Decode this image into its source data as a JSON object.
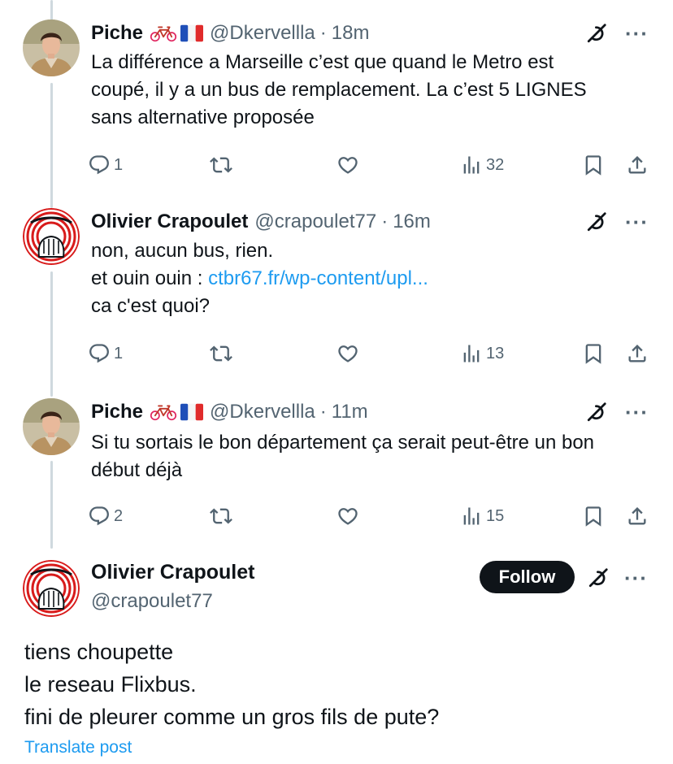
{
  "colors": {
    "text": "#0f1419",
    "secondary": "#536471",
    "link": "#1d9bf0",
    "thread_line": "#cfd9de",
    "follow_bg": "#0f1419"
  },
  "replies": [
    {
      "name": "Piche",
      "handle": "@Dkervellla",
      "separator": "·",
      "time": "18m",
      "emojis": [
        "bicycle-emoji",
        "france-flag-emoji"
      ],
      "lines": [
        "La différence a Marseille c’est que quand le Metro est",
        "coupé, il y a un bus de remplacement. La c’est 5 LIGNES",
        "sans alternative proposée"
      ],
      "reply_count": "1",
      "views": "32"
    },
    {
      "name": "Olivier Crapoulet",
      "handle": "@crapoulet77",
      "separator": "·",
      "time": "16m",
      "lines": [
        "non, aucun bus, rien."
      ],
      "link_prefix": "et ouin ouin : ",
      "link_text": "ctbr67.fr/wp-content/upl...",
      "lines_after": [
        "ca c'est quoi?"
      ],
      "reply_count": "1",
      "views": "13"
    },
    {
      "name": "Piche",
      "handle": "@Dkervellla",
      "separator": "·",
      "time": "11m",
      "emojis": [
        "bicycle-emoji",
        "france-flag-emoji"
      ],
      "lines": [
        "Si tu sortais le bon département ça serait peut-être un bon",
        "début déjà"
      ],
      "reply_count": "2",
      "views": "15"
    }
  ],
  "main_post": {
    "name": "Olivier Crapoulet",
    "handle": "@crapoulet77",
    "follow_label": "Follow",
    "lines": [
      "tiens choupette",
      "le reseau Flixbus.",
      "fini de pleurer comme un gros fils de pute?"
    ],
    "translate_label": "Translate post"
  },
  "icons": {
    "reply": "reply-icon",
    "repost": "repost-icon",
    "like": "like-icon",
    "views": "views-icon",
    "bookmark": "bookmark-icon",
    "share": "share-icon",
    "grok": "grok-icon",
    "more": "more-icon"
  },
  "more_glyph": "···"
}
